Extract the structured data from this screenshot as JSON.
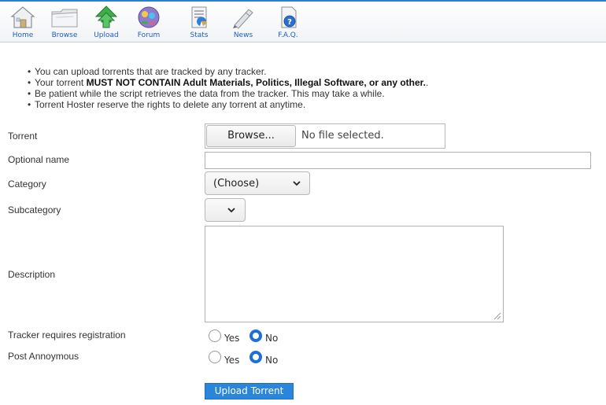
{
  "nav": {
    "items": [
      {
        "label": "Home",
        "icon": "home-icon"
      },
      {
        "label": "Browse",
        "icon": "folder-icon"
      },
      {
        "label": "Upload",
        "icon": "upload-arrow-icon"
      },
      {
        "label": "Forum",
        "icon": "forum-people-icon"
      },
      {
        "label": "Stats",
        "icon": "stats-chart-icon"
      },
      {
        "label": "News",
        "icon": "news-pen-icon"
      },
      {
        "label": "F.A.Q.",
        "icon": "help-question-icon"
      }
    ]
  },
  "notes": {
    "line1": "You can upload torrents that are tracked by any tracker.",
    "line2_pre": "Your torrent ",
    "line2_bold": "MUST NOT CONTAIN Adult Materials, Politics, Illegal Software, or any other.",
    "line2_post": ".",
    "line3": "Be patient while the script retrieves the data from the tracker. This may take a while.",
    "line4": "Torrent Hoster reserve the rights to delete any torrent at anytime."
  },
  "form": {
    "torrent_label": "Torrent",
    "browse_label": "Browse...",
    "file_status": "No file selected.",
    "optional_name_label": "Optional name",
    "optional_name_value": "",
    "category_label": "Category",
    "category_value": "(Choose)",
    "subcategory_label": "Subcategory",
    "subcategory_value": "",
    "description_label": "Description",
    "description_value": "",
    "tracker_reg_label": "Tracker requires registration",
    "post_anon_label": "Post Annoymous",
    "yes_label": "Yes",
    "no_label": "No",
    "tracker_reg_selected": "No",
    "post_anon_selected": "No",
    "submit_label": "Upload Torrent"
  },
  "colors": {
    "accent": "#1e6fd9",
    "nav_link": "#1f5fbf",
    "submit_bg": "#2a86db"
  }
}
